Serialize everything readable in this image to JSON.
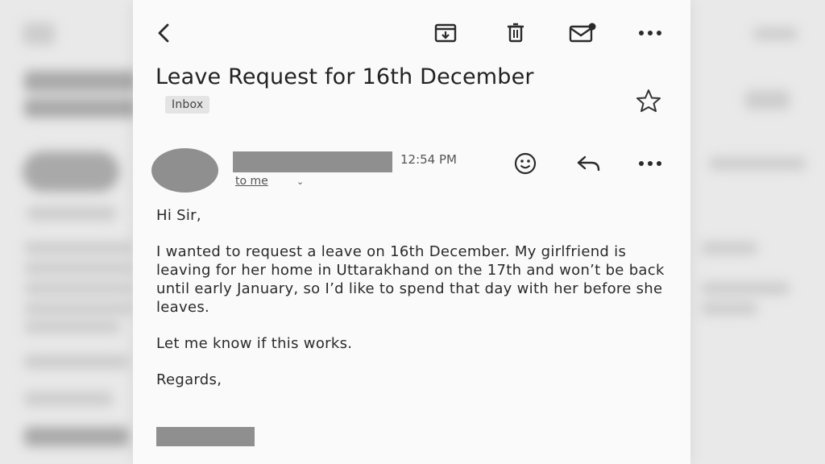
{
  "colors": {
    "card_bg": "#fafafa",
    "redaction": "#8f8f8f",
    "badge_bg": "#e4e4e4"
  },
  "toolbar": {
    "back_icon": "chevron-left-icon",
    "archive_icon": "archive-icon",
    "delete_icon": "trash-icon",
    "mark_unread_icon": "mail-unread-icon",
    "more_icon": "more-horizontal-icon"
  },
  "email": {
    "subject": "Leave Request for 16th December",
    "label": "Inbox",
    "time": "12:54 PM",
    "recipient_text": "to me",
    "body_paragraphs": [
      "Hi Sir,",
      "I wanted to request a leave on 16th December. My girlfriend is leaving for her home in Uttarakhand on the 17th and won’t be back until early January, so I’d like to spend that day with her before she leaves.",
      "Let me know if this works.",
      "Regards,"
    ]
  }
}
